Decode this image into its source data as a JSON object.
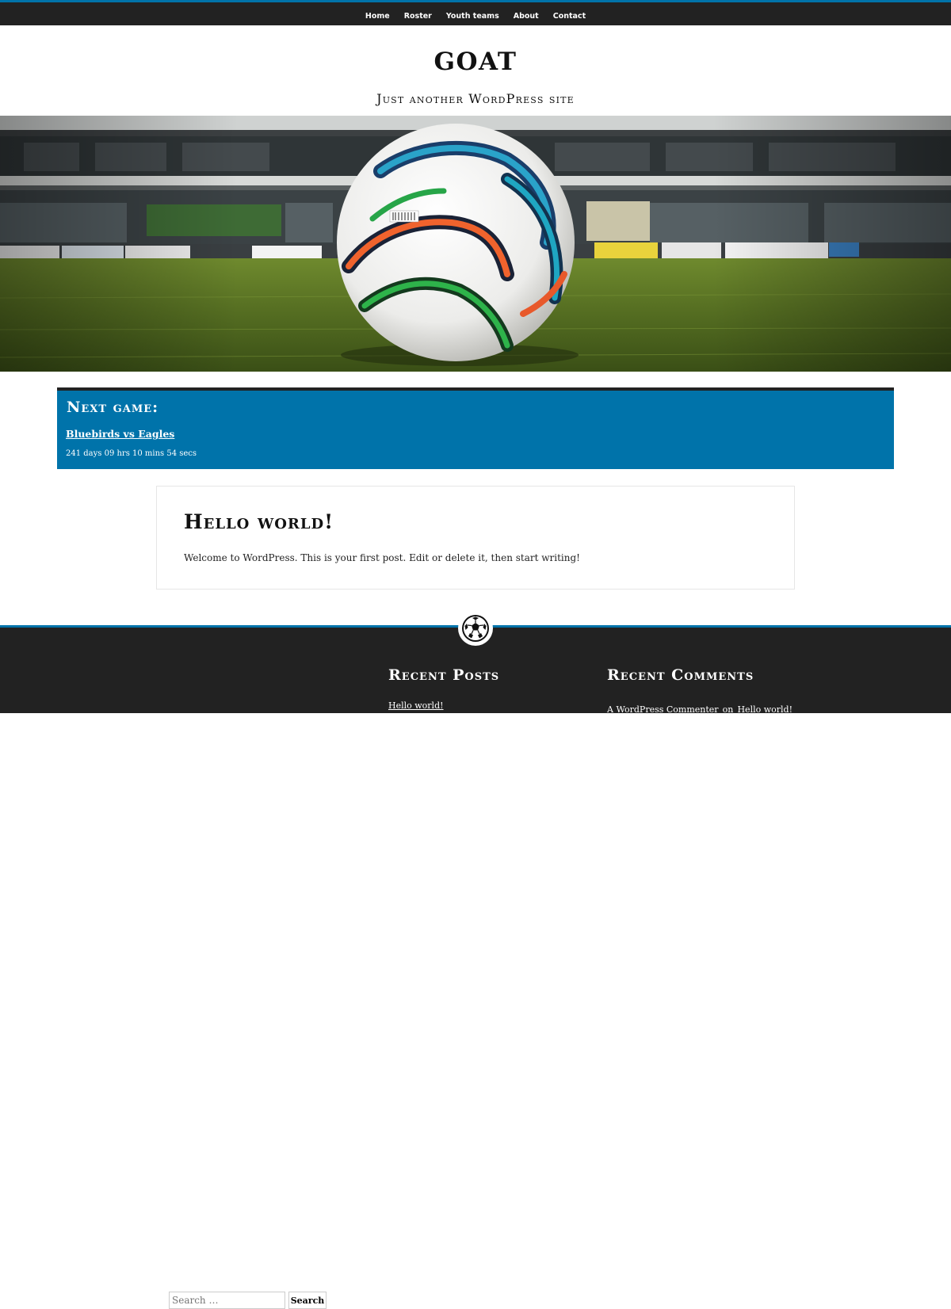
{
  "nav": {
    "items": [
      {
        "label": "Home"
      },
      {
        "label": "Roster"
      },
      {
        "label": "Youth teams"
      },
      {
        "label": "About"
      },
      {
        "label": "Contact"
      }
    ]
  },
  "site": {
    "title": "GOAT",
    "description": "Just another WordPress site"
  },
  "hero": {
    "image": "soccer-ball-stadium-photo"
  },
  "next_game": {
    "heading": "Next game:",
    "match_link": "Bluebirds vs Eagles",
    "countdown": "241 days 09 hrs 10 mins 54 secs"
  },
  "post": {
    "title": "Hello world!",
    "excerpt": "Welcome to WordPress. This is your first post. Edit or delete it, then start writing!"
  },
  "footer": {
    "search": {
      "placeholder": "Search …",
      "button_label": "Search"
    },
    "recent_posts": {
      "title": "Recent Posts",
      "items": [
        {
          "label": "Hello world!"
        }
      ]
    },
    "recent_comments": {
      "title": "Recent Comments",
      "author": "A WordPress Commenter",
      "connector": "on",
      "post": "Hello world!"
    },
    "badge_icon": "soccer-ball-icon"
  },
  "colors": {
    "accent": "#0073aa",
    "dark": "#222222",
    "white": "#ffffff"
  }
}
